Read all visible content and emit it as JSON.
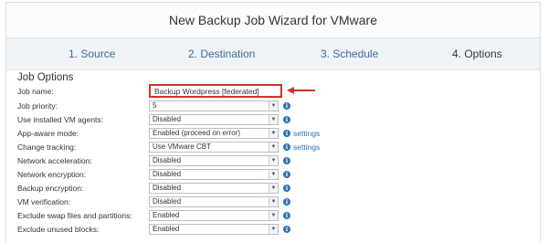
{
  "header": {
    "title": "New Backup Job Wizard for VMware"
  },
  "steps": [
    {
      "label": "1. Source"
    },
    {
      "label": "2. Destination"
    },
    {
      "label": "3. Schedule"
    },
    {
      "label": "4. Options"
    }
  ],
  "section": {
    "title": "Job Options"
  },
  "job_name": {
    "label": "Job name:",
    "value": "Backup Wordpress [federated]"
  },
  "options": [
    {
      "label": "Job priority:",
      "value": "5"
    },
    {
      "label": "Use installed VM agents:",
      "value": "Disabled"
    },
    {
      "label": "App-aware mode:",
      "value": "Enabled (proceed on error)",
      "settings": "settings"
    },
    {
      "label": "Change tracking:",
      "value": "Use VMware CBT",
      "settings": "settings"
    },
    {
      "label": "Network acceleration:",
      "value": "Disabled"
    },
    {
      "label": "Network encryption:",
      "value": "Disabled"
    },
    {
      "label": "Backup encryption:",
      "value": "Disabled"
    },
    {
      "label": "VM verification:",
      "value": "Disabled"
    },
    {
      "label": "Exclude swap files and partitions:",
      "value": "Enabled"
    },
    {
      "label": "Exclude unused blocks:",
      "value": "Enabled"
    }
  ],
  "icons": {
    "info": "info-icon",
    "dropdown": "chevron-down-icon",
    "annotation": "red-arrow-icon"
  },
  "colors": {
    "link": "#2f72b8",
    "highlight": "#d0312d"
  }
}
